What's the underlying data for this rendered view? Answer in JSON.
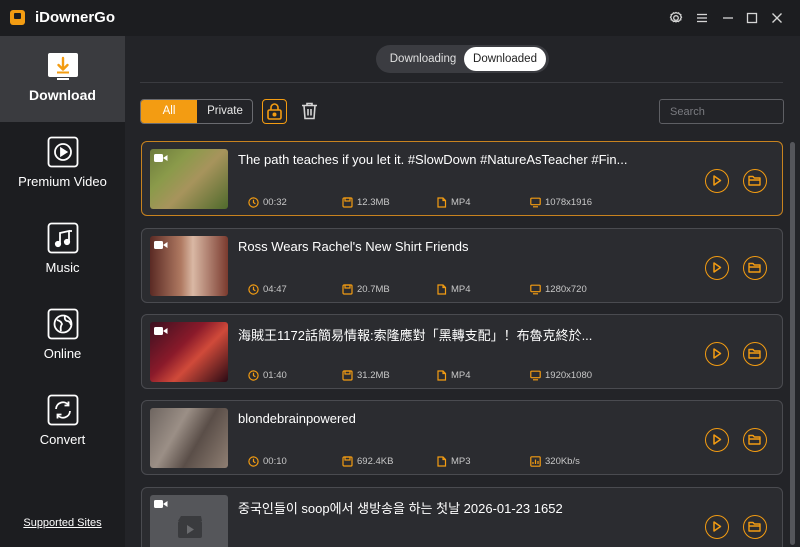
{
  "app": {
    "title": "iDownerGo",
    "accent": "#f39c12"
  },
  "window_controls": [
    "gear-icon",
    "menu-icon",
    "minimize-icon",
    "maximize-icon",
    "close-icon"
  ],
  "sidebar": {
    "items": [
      {
        "label": "Download",
        "icon": "download-icon",
        "active": true
      },
      {
        "label": "Premium Video",
        "icon": "play-icon"
      },
      {
        "label": "Music",
        "icon": "music-icon"
      },
      {
        "label": "Online",
        "icon": "globe-icon"
      },
      {
        "label": "Convert",
        "icon": "convert-icon"
      }
    ],
    "footer_link": "Supported Sites"
  },
  "tabs": {
    "downloading": "Downloading",
    "downloaded": "Downloaded",
    "active": "Downloaded"
  },
  "filter": {
    "all": "All",
    "private": "Private",
    "active": "All"
  },
  "search": {
    "placeholder": "Search",
    "value": ""
  },
  "items": [
    {
      "title": "The path teaches if you let it. #SlowDown #NatureAsTeacher #Fin...",
      "duration": "00:32",
      "size": "12.3MB",
      "format": "MP4",
      "quality": "1078x1916",
      "selected": true
    },
    {
      "title": "Ross Wears Rachel's New Shirt Friends",
      "duration": "04:47",
      "size": "20.7MB",
      "format": "MP4",
      "quality": "1280x720"
    },
    {
      "title": "海賊王1172話簡易情報:索隆應對「黑轉支配」！布魯克終於...",
      "duration": "01:40",
      "size": "31.2MB",
      "format": "MP4",
      "quality": "1920x1080"
    },
    {
      "title": "blondebrainpowered",
      "duration": "00:10",
      "size": "692.4KB",
      "format": "MP3",
      "quality": "320Kb/s"
    },
    {
      "title": "중국인들이 soop에서 생방송을 하는 첫날 2026-01-23 1652",
      "duration": "",
      "size": "",
      "format": "",
      "quality": ""
    }
  ]
}
